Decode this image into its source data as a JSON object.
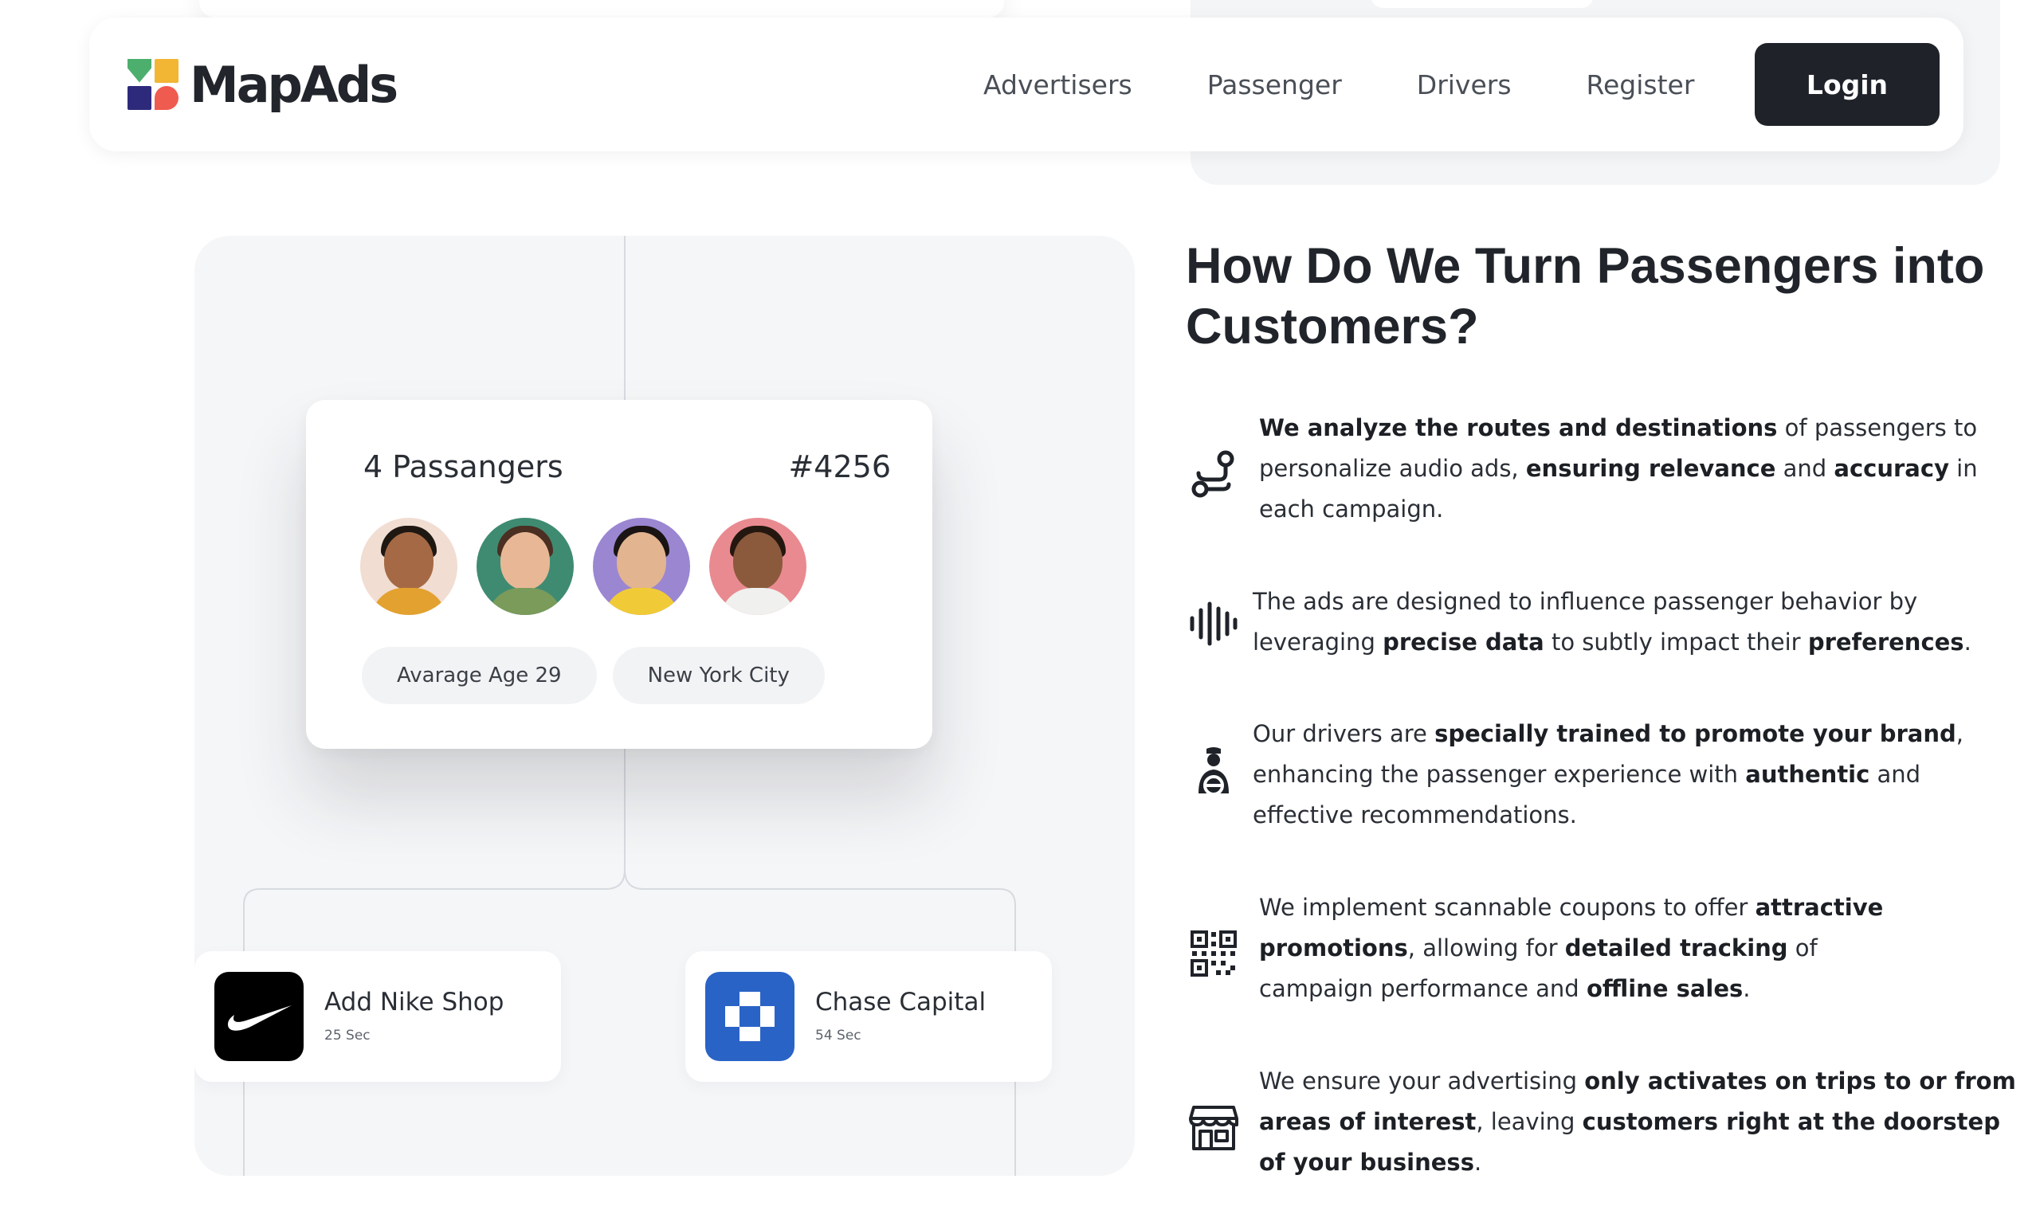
{
  "nav": {
    "logo_text": "MapAds",
    "links": [
      "Advertisers",
      "Passenger",
      "Drivers",
      "Register"
    ],
    "login_label": "Login"
  },
  "illustration": {
    "passenger_card": {
      "count_label": "4 Passangers",
      "id_label": "#4256",
      "tags": [
        "Avarage Age 29",
        "New York City"
      ]
    },
    "ads": [
      {
        "name": "Add Nike Shop",
        "duration": "25 Sec",
        "icon": "nike-swoosh-icon",
        "bg_color": "#000000"
      },
      {
        "name": "Chase Capital",
        "duration": "54 Sec",
        "icon": "chase-octagon-icon",
        "bg_color": "#2a63c6"
      }
    ]
  },
  "section": {
    "title": "How Do We Turn Passengers into Customers?",
    "features": [
      {
        "icon": "route-icon",
        "parts": [
          {
            "t": "We analyze the routes and destinations",
            "b": true
          },
          {
            "t": " of passengers to personalize audio ads, ",
            "b": false
          },
          {
            "t": "ensuring relevance",
            "b": true
          },
          {
            "t": " and ",
            "b": false
          },
          {
            "t": "accuracy",
            "b": true
          },
          {
            "t": " in each campaign.",
            "b": false
          }
        ]
      },
      {
        "icon": "sound-wave-icon",
        "parts": [
          {
            "t": "The ads are designed to influence passenger behavior by leveraging ",
            "b": false
          },
          {
            "t": "precise data",
            "b": true
          },
          {
            "t": " to subtly impact their ",
            "b": false
          },
          {
            "t": "preferences",
            "b": true
          },
          {
            "t": ".",
            "b": false
          }
        ]
      },
      {
        "icon": "driver-icon",
        "parts": [
          {
            "t": "Our drivers are ",
            "b": false
          },
          {
            "t": "specially trained to promote your brand",
            "b": true
          },
          {
            "t": ", enhancing the passenger experience with ",
            "b": false
          },
          {
            "t": "authentic",
            "b": true
          },
          {
            "t": " and effective recommendations.",
            "b": false
          }
        ]
      },
      {
        "icon": "qr-code-icon",
        "parts": [
          {
            "t": "We implement scannable coupons to offer ",
            "b": false
          },
          {
            "t": "attractive promotions",
            "b": true
          },
          {
            "t": ", allowing for ",
            "b": false
          },
          {
            "t": "detailed tracking",
            "b": true
          },
          {
            "t": " of campaign performance and ",
            "b": false
          },
          {
            "t": "offline sales",
            "b": true
          },
          {
            "t": ".",
            "b": false
          }
        ]
      },
      {
        "icon": "storefront-icon",
        "parts": [
          {
            "t": "We ensure your advertising ",
            "b": false
          },
          {
            "t": "only activates on trips to or from areas of interest",
            "b": true
          },
          {
            "t": ", leaving ",
            "b": false
          },
          {
            "t": "customers right at the doorstep of your business",
            "b": true
          },
          {
            "t": ".",
            "b": false
          }
        ]
      }
    ]
  }
}
